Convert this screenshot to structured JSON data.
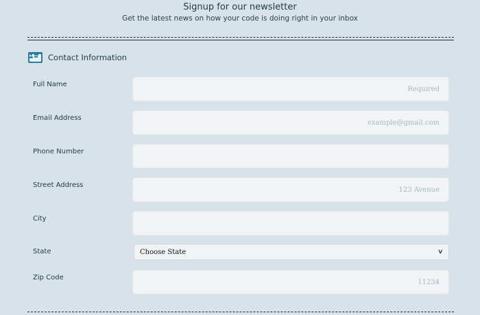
{
  "header": {
    "title": "Signup for our newsletter",
    "subtitle": "Get the latest news on how your code is doing right in your inbox"
  },
  "section": {
    "icon": "id-card-icon",
    "title": "Contact Information",
    "accent_color": "#2d7c9c"
  },
  "form": {
    "full_name": {
      "label": "Full Name",
      "value": "",
      "placeholder": "Required"
    },
    "email": {
      "label": "Email Address",
      "value": "",
      "placeholder": "example@gmail.com"
    },
    "phone": {
      "label": "Phone Number",
      "value": "",
      "placeholder": ""
    },
    "street": {
      "label": "Street Address",
      "value": "",
      "placeholder": "123 Avenue"
    },
    "city": {
      "label": "City",
      "value": "",
      "placeholder": ""
    },
    "state": {
      "label": "State",
      "selected": "Choose State"
    },
    "zip": {
      "label": "Zip Code",
      "value": "",
      "placeholder": "11234"
    }
  },
  "colors": {
    "background": "#d8e3e9",
    "input_background": "#f1f3f5",
    "placeholder": "#a8b8c0",
    "text": "#1f3a44"
  }
}
